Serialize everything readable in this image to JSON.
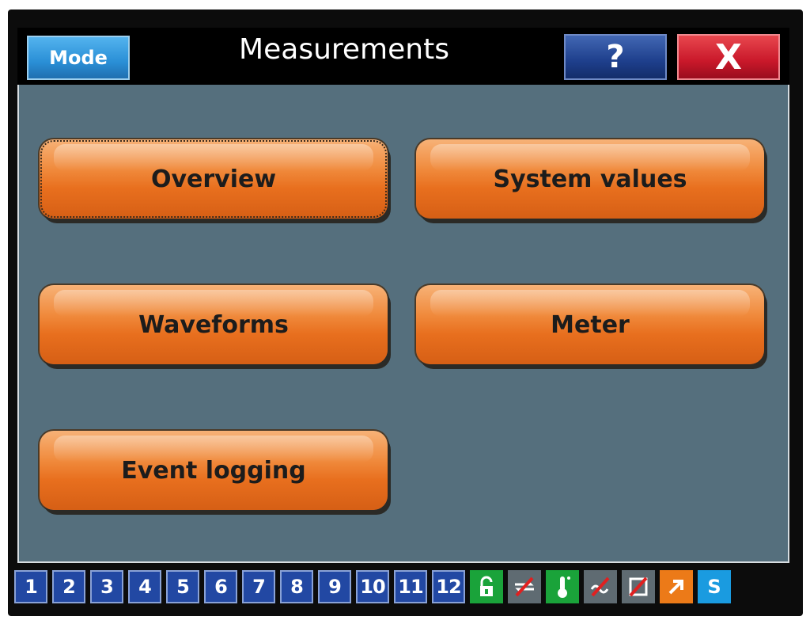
{
  "header": {
    "title": "Measurements",
    "mode_label": "Mode",
    "help_label": "?",
    "close_label": "X"
  },
  "menu": {
    "overview": "Overview",
    "system_values": "System values",
    "waveforms": "Waveforms",
    "meter": "Meter",
    "event_logging": "Event logging"
  },
  "statusbar": {
    "tabs": [
      "1",
      "2",
      "3",
      "4",
      "5",
      "6",
      "7",
      "8",
      "9",
      "10",
      "11",
      "12"
    ],
    "icons": [
      "unlock-icon",
      "swap-arrows-disabled-icon",
      "thermometer-icon",
      "link-disabled-icon",
      "device-disabled-icon",
      "arrow-up-right-icon",
      "s-icon"
    ],
    "s_label": "S"
  },
  "colors": {
    "screen_bg": "#556f7d",
    "menu_button": "#f08a3c",
    "mode_button": "#2a8fd6",
    "help_button": "#1e3f8c",
    "close_button": "#c9182a",
    "tab_blue": "#2248a3"
  }
}
